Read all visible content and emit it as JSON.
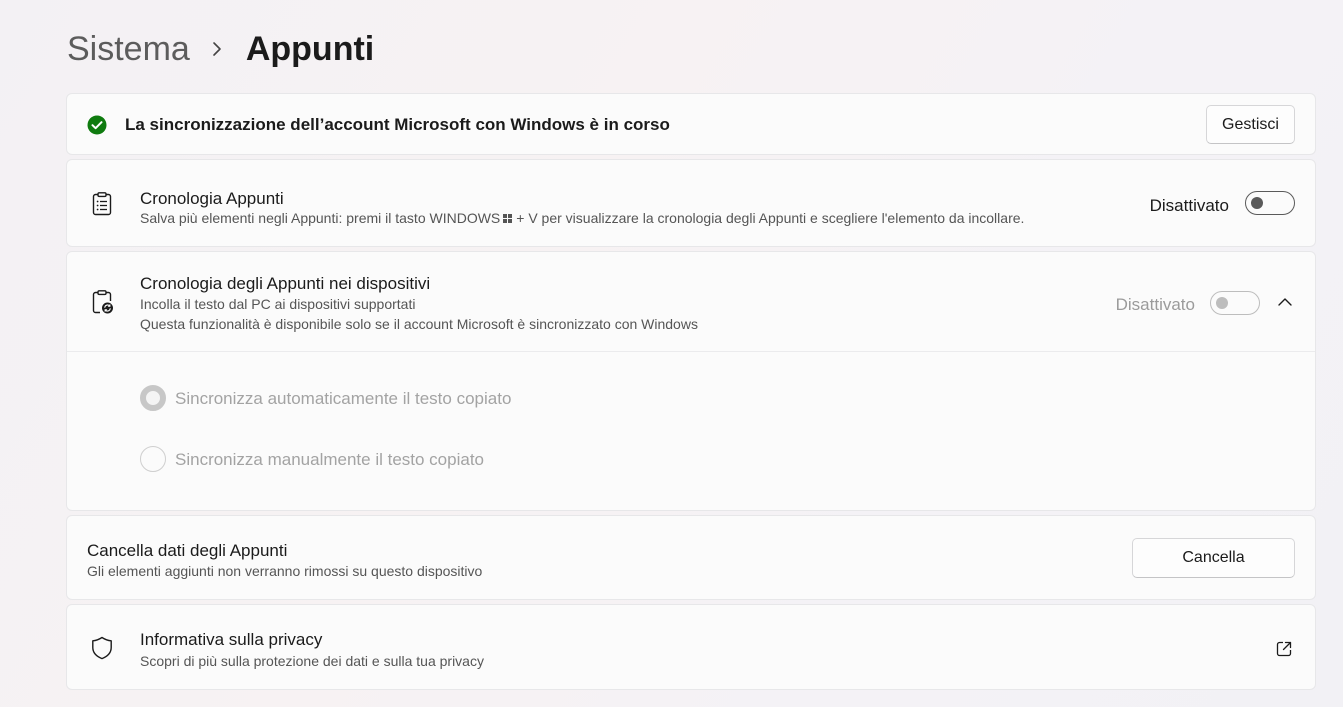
{
  "breadcrumb": {
    "parent": "Sistema",
    "current": "Appunti"
  },
  "sync_banner": {
    "text": "La sincronizzazione dell’account Microsoft con Windows è in corso",
    "button": "Gestisci",
    "status_color": "#0f7b0f"
  },
  "clipboard_history": {
    "title": "Cronologia Appunti",
    "desc_before": "Salva più elementi negli Appunti: premi il tasto WINDOWS",
    "desc_after": "+ V per visualizzare la cronologia degli Appunti e scegliere l'elemento da incollare.",
    "toggle_label": "Disattivato",
    "toggle_on": false
  },
  "devices_history": {
    "title": "Cronologia degli Appunti nei dispositivi",
    "desc_line1": "Incolla il testo dal PC ai dispositivi supportati",
    "desc_line2": "Questa funzionalità è disponibile solo se il account Microsoft è sincronizzato con Windows",
    "toggle_label": "Disattivato",
    "toggle_on": false,
    "options": [
      {
        "label": "Sincronizza automaticamente il testo copiato",
        "selected": true
      },
      {
        "label": "Sincronizza manualmente il testo copiato",
        "selected": false
      }
    ]
  },
  "clear_data": {
    "title": "Cancella dati degli Appunti",
    "desc": "Gli elementi aggiunti non verranno rimossi su questo dispositivo",
    "button": "Cancella"
  },
  "privacy": {
    "title": "Informativa sulla privacy",
    "desc": "Scopri di più sulla protezione dei dati e sulla tua privacy"
  }
}
